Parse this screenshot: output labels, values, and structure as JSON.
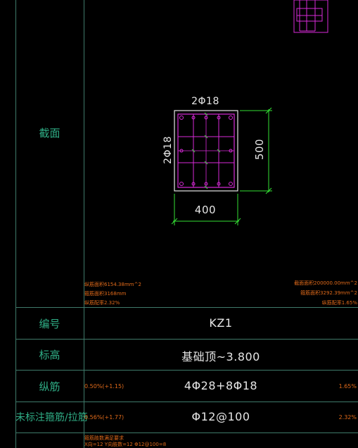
{
  "rows": {
    "section_label": "截面",
    "number_label": "编号",
    "number_value": "KZ1",
    "elevation_label": "标高",
    "elevation_value": "基础顶~3.800",
    "longitudinal_label": "纵筋",
    "longitudinal_value": "4Φ28+8Φ18",
    "longitudinal_left_pct": "0.50%(+1.15)",
    "longitudinal_right_pct": "1.65%",
    "stirrup_label": "未标注箍筋/拉筋",
    "stirrup_value": "Φ12@100",
    "stirrup_left_pct": "0.56%(+1.77)",
    "stirrup_right_pct": "2.32%"
  },
  "section": {
    "top_rebar": "2Φ18",
    "side_rebar": "2Φ18",
    "width": "400",
    "height": "500"
  },
  "notes": {
    "left": [
      "纵筋面积6154.38mm^2",
      "箍筋面积3168mm",
      "纵筋配率2.32%"
    ],
    "right": [
      "截面面积200000.00mm^2",
      "箍筋面积3292.39mm^2",
      "纵筋配率1.65%"
    ],
    "bottom": [
      "箍筋肢数满足要求",
      "X向=12 Y向肢数=12 Φ12@100=8"
    ]
  },
  "colors": {
    "grid": "#3f7a6a",
    "label": "#2fae86",
    "value": "#e6e6e6",
    "note": "#e06a1a",
    "rebar": "#d82ad8",
    "concrete": "#e6e6e6",
    "dimension": "#35e035"
  }
}
